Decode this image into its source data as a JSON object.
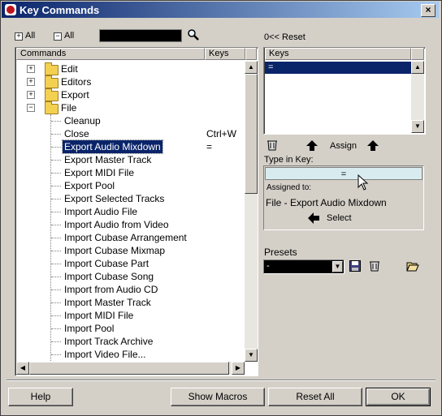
{
  "window": {
    "title": "Key Commands",
    "close_glyph": "×"
  },
  "toolbar": {
    "expand_all": "All",
    "collapse_all": "All",
    "search_value": "",
    "search_icon": "magnifier-icon",
    "reset_prefix": "0<<",
    "reset_label": "Reset"
  },
  "commands": {
    "headers": {
      "commands": "Commands",
      "keys": "Keys"
    },
    "folders": [
      {
        "label": "Edit",
        "expanded": false
      },
      {
        "label": "Editors",
        "expanded": false
      },
      {
        "label": "Export",
        "expanded": false
      },
      {
        "label": "File",
        "expanded": true
      }
    ],
    "items": [
      {
        "label": "Cleanup",
        "key": ""
      },
      {
        "label": "Close",
        "key": "Ctrl+W"
      },
      {
        "label": "Export Audio Mixdown",
        "key": "=",
        "selected": true
      },
      {
        "label": "Export Master Track",
        "key": ""
      },
      {
        "label": "Export MIDI File",
        "key": ""
      },
      {
        "label": "Export Pool",
        "key": ""
      },
      {
        "label": "Export Selected Tracks",
        "key": ""
      },
      {
        "label": "Import Audio File",
        "key": ""
      },
      {
        "label": "Import Audio from Video",
        "key": ""
      },
      {
        "label": "Import Cubase Arrangement",
        "key": ""
      },
      {
        "label": "Import Cubase Mixmap",
        "key": ""
      },
      {
        "label": "Import Cubase Part",
        "key": ""
      },
      {
        "label": "Import Cubase Song",
        "key": ""
      },
      {
        "label": "Import from Audio CD",
        "key": ""
      },
      {
        "label": "Import Master Track",
        "key": ""
      },
      {
        "label": "Import MIDI File",
        "key": ""
      },
      {
        "label": "Import Pool",
        "key": ""
      },
      {
        "label": "Import Track Archive",
        "key": ""
      },
      {
        "label": "Import Video File...",
        "key": ""
      }
    ]
  },
  "keys_panel": {
    "header": "Keys",
    "items": [
      "="
    ],
    "assign_label": "Assign",
    "type_in_key_label": "Type in Key:",
    "type_in_key_value": "=",
    "assigned_to_label": "Assigned to:",
    "assigned_to_value": "File - Export Audio Mixdown",
    "select_label": "Select"
  },
  "presets": {
    "label": "Presets",
    "selected": "-"
  },
  "buttons": {
    "help": "Help",
    "show_macros": "Show Macros",
    "reset_all": "Reset All",
    "ok": "OK"
  },
  "colors": {
    "selection": "#0a246a",
    "title_gradient_start": "#0a246a",
    "title_gradient_end": "#a6caf0",
    "key_selection": "#0a246a",
    "type_in_key_bg": "#d8ecf0"
  }
}
